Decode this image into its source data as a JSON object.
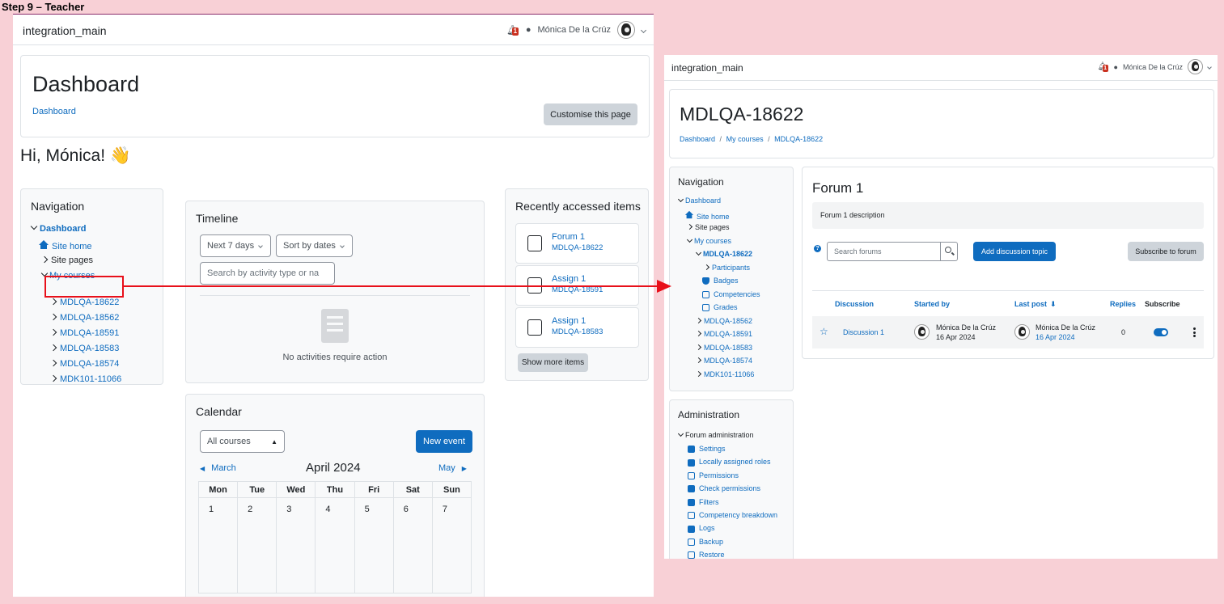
{
  "step_label": "Step 9 – Teacher",
  "left": {
    "site_name": "integration_main",
    "notification_count": "1",
    "user_name": "Mónica De la Crúz",
    "page_title": "Dashboard",
    "breadcrumb": "Dashboard",
    "customise_label": "Customise this page",
    "greeting": "Hi, Mónica! 👋",
    "navigation": {
      "title": "Navigation",
      "dashboard": "Dashboard",
      "site_home": "Site home",
      "site_pages": "Site pages",
      "my_courses": "My courses",
      "courses": [
        "MDLQA-18622",
        "MDLQA-18562",
        "MDLQA-18591",
        "MDLQA-18583",
        "MDLQA-18574",
        "MDK101-11066"
      ]
    },
    "timeline": {
      "title": "Timeline",
      "filter_label": "Next 7 days",
      "sort_label": "Sort by dates",
      "search_placeholder": "Search by activity type or na",
      "empty_text": "No activities require action"
    },
    "calendar": {
      "title": "Calendar",
      "course_filter": "All courses",
      "new_event": "New event",
      "prev_month": "March",
      "current_month": "April 2024",
      "next_month": "May",
      "days": [
        "Mon",
        "Tue",
        "Wed",
        "Thu",
        "Fri",
        "Sat",
        "Sun"
      ],
      "dates": [
        "1",
        "2",
        "3",
        "4",
        "5",
        "6",
        "7"
      ]
    },
    "recent": {
      "title": "Recently accessed items",
      "items": [
        {
          "name": "Forum 1",
          "course": "MDLQA-18622"
        },
        {
          "name": "Assign 1",
          "course": "MDLQA-18591"
        },
        {
          "name": "Assign 1",
          "course": "MDLQA-18583"
        }
      ],
      "show_more": "Show more items"
    }
  },
  "right": {
    "site_name": "integration_main",
    "notification_count": "1",
    "user_name": "Mónica De la Crúz",
    "course_title": "MDLQA-18622",
    "breadcrumb": {
      "home": "Dashboard",
      "courses": "My courses",
      "course": "MDLQA-18622",
      "sep": "/"
    },
    "navigation": {
      "title": "Navigation",
      "dashboard": "Dashboard",
      "site_home": "Site home",
      "site_pages": "Site pages",
      "my_courses": "My courses",
      "current_course": "MDLQA-18622",
      "participants": "Participants",
      "badges": "Badges",
      "competencies": "Competencies",
      "grades": "Grades",
      "other_courses": [
        "MDLQA-18562",
        "MDLQA-18591",
        "MDLQA-18583",
        "MDLQA-18574",
        "MDK101-11066"
      ]
    },
    "administration": {
      "title": "Administration",
      "section": "Forum administration",
      "items": [
        "Settings",
        "Locally assigned roles",
        "Permissions",
        "Check permissions",
        "Filters",
        "Competency breakdown",
        "Logs",
        "Backup",
        "Restore"
      ]
    },
    "forum": {
      "title": "Forum 1",
      "description": "Forum 1 description",
      "search_placeholder": "Search forums",
      "add_topic": "Add discussion topic",
      "subscribe": "Subscribe to forum",
      "headers": {
        "discussion": "Discussion",
        "started_by": "Started by",
        "last_post": "Last post",
        "replies": "Replies",
        "subscribe": "Subscribe"
      },
      "row": {
        "discussion": "Discussion 1",
        "started_by_name": "Mónica De la Crúz",
        "started_by_date": "16 Apr 2024",
        "last_post_name": "Mónica De la Crúz",
        "last_post_date": "16 Apr 2024",
        "replies": "0"
      }
    }
  },
  "colors": {
    "background": "#f8d0d6",
    "link": "#0f6cbf",
    "annotation": "#e8101a",
    "badge": "#ca3120"
  }
}
